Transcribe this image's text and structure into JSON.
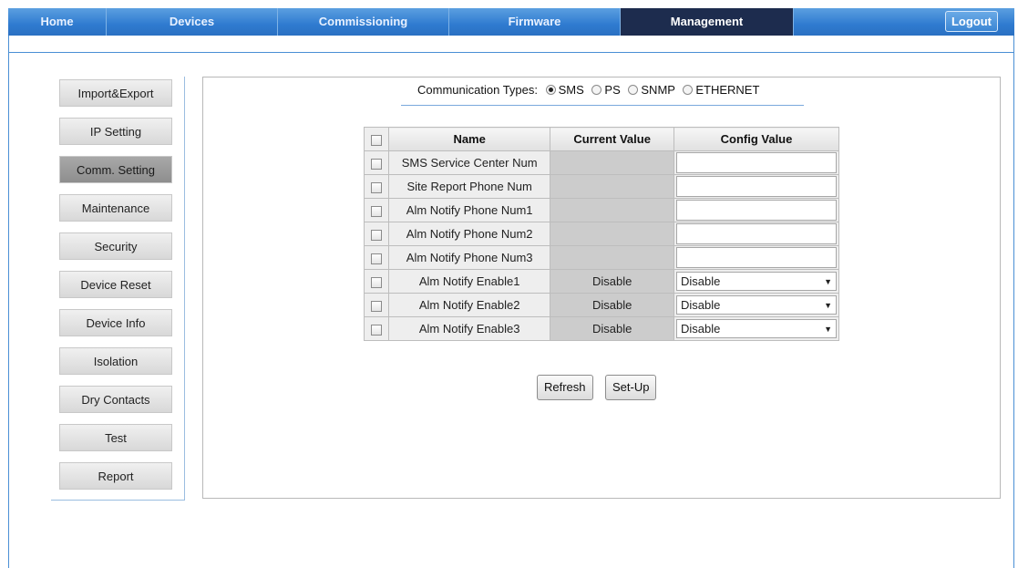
{
  "topnav": {
    "tabs": [
      {
        "label": "Home"
      },
      {
        "label": "Devices"
      },
      {
        "label": "Commissioning"
      },
      {
        "label": "Firmware"
      },
      {
        "label": "Management",
        "active": true
      }
    ],
    "logout_label": "Logout"
  },
  "sidebar": {
    "items": [
      {
        "label": "Import&Export"
      },
      {
        "label": "IP Setting"
      },
      {
        "label": "Comm. Setting",
        "active": true
      },
      {
        "label": "Maintenance"
      },
      {
        "label": "Security"
      },
      {
        "label": "Device Reset"
      },
      {
        "label": "Device Info"
      },
      {
        "label": "Isolation"
      },
      {
        "label": "Dry Contacts"
      },
      {
        "label": "Test"
      },
      {
        "label": "Report"
      }
    ]
  },
  "comm_types": {
    "label": "Communication Types:",
    "options": [
      {
        "label": "SMS",
        "selected": true
      },
      {
        "label": "PS",
        "selected": false
      },
      {
        "label": "SNMP",
        "selected": false
      },
      {
        "label": "ETHERNET",
        "selected": false
      }
    ]
  },
  "table": {
    "headers": {
      "name": "Name",
      "current": "Current Value",
      "config": "Config Value"
    },
    "rows": [
      {
        "name": "SMS Service Center Num",
        "current": "",
        "config": ""
      },
      {
        "name": "Site Report Phone Num",
        "current": "",
        "config": ""
      },
      {
        "name": "Alm Notify Phone Num1",
        "current": "",
        "config": ""
      },
      {
        "name": "Alm Notify Phone Num2",
        "current": "",
        "config": ""
      },
      {
        "name": "Alm Notify Phone Num3",
        "current": "",
        "config": ""
      },
      {
        "name": "Alm Notify Enable1",
        "current": "Disable",
        "config": "Disable"
      },
      {
        "name": "Alm Notify Enable2",
        "current": "Disable",
        "config": "Disable"
      },
      {
        "name": "Alm Notify Enable3",
        "current": "Disable",
        "config": "Disable"
      }
    ]
  },
  "actions": {
    "refresh_label": "Refresh",
    "setup_label": "Set-Up"
  },
  "colors": {
    "nav_blue": "#2f7bd0",
    "nav_active": "#1d2c4e",
    "frame_blue": "#4a8fd5"
  }
}
